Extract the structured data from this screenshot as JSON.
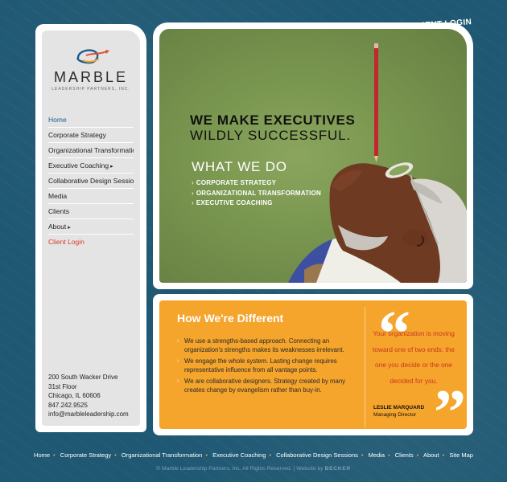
{
  "header": {
    "client_login": "CLIENT LOGIN"
  },
  "logo": {
    "name": "MARBLE",
    "tagline": "LEADERSHIP PARTNERS, INC."
  },
  "nav": [
    {
      "label": "Home"
    },
    {
      "label": "Corporate Strategy"
    },
    {
      "label": "Organizational Transformation"
    },
    {
      "label": "Executive Coaching"
    },
    {
      "label": "Collaborative Design Sessions"
    },
    {
      "label": "Media"
    },
    {
      "label": "Clients"
    },
    {
      "label": "About"
    },
    {
      "label": "Client Login"
    }
  ],
  "address": {
    "line1": "200 South Wacker Drive",
    "line2": "31st Floor",
    "line3": "Chicago, IL 60606",
    "phone": "847.242.9525",
    "email": "info@marbleleadership.com"
  },
  "hero": {
    "headline1": "WE MAKE EXECUTIVES",
    "headline2": "WILDLY SUCCESSFUL.",
    "what_we_do": "WHAT WE DO",
    "services": [
      "CORPORATE STRATEGY",
      "ORGANIZATIONAL TRANSFORMATION",
      "EXECUTIVE COACHING"
    ]
  },
  "different": {
    "title": "How We're Different",
    "points": [
      "We use a strengths-based approach. Connecting an organization's strengths makes its weaknesses irrelevant.",
      "We engage the whole system. Lasting change requires representative influence from all vantage points.",
      "We are collaborative designers. Strategy created by many creates change by evangelism rather than buy-in."
    ],
    "quote": "Your organization is moving toward one of two ends: the one you decide or the one decided for you.",
    "author": "LESLIE MARQUARD",
    "author_title": "Managing Director"
  },
  "footer": {
    "links": [
      "Home",
      "Corporate Strategy",
      "Organizational Transformation",
      "Executive Coaching",
      "Collaborative Design Sessions",
      "Media",
      "Clients",
      "About",
      "Site Map"
    ],
    "copyright": "© Marble Leadership Partners, Inc. All Rights Reserved. | Website by",
    "credit": "BECKER"
  },
  "colors": {
    "background": "#1f5873",
    "accent_orange": "#f5a42c",
    "nav_active": "#1f5d8e",
    "client_login_red": "#d83a2a",
    "quote_red": "#c9391f"
  }
}
